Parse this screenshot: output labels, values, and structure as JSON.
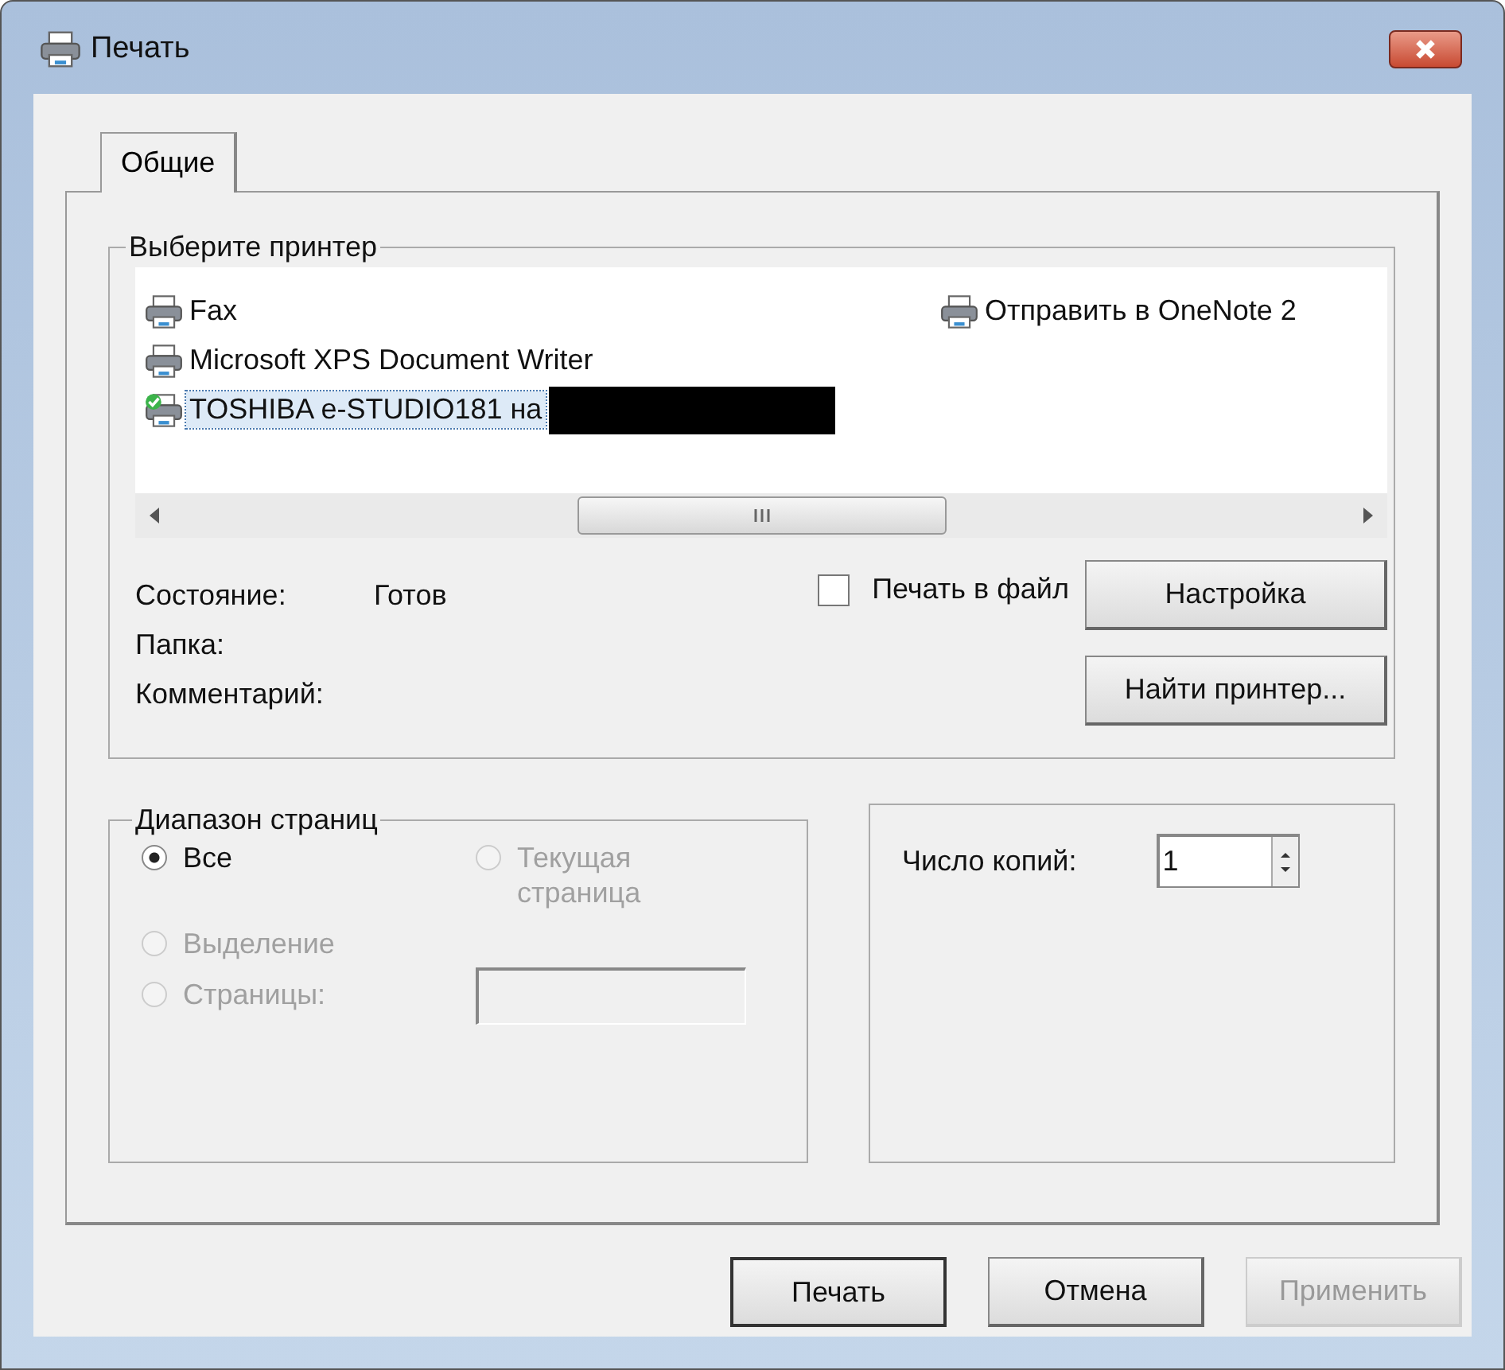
{
  "window": {
    "title": "Печать"
  },
  "tabs": [
    {
      "label": "Общие",
      "selected": true
    }
  ],
  "printer_group": {
    "title": "Выберите принтер",
    "printers": [
      {
        "name": "Fax",
        "selected": false,
        "default": false,
        "redacted": false
      },
      {
        "name": "Microsoft XPS Document Writer",
        "selected": false,
        "default": false,
        "redacted": false
      },
      {
        "name": "TOSHIBA e-STUDIO181 на",
        "selected": true,
        "default": true,
        "redacted": true
      },
      {
        "name": "Отправить в OneNote 2",
        "selected": false,
        "default": false,
        "redacted": false
      }
    ],
    "status": [
      {
        "label": "Состояние:",
        "value": "Готов"
      },
      {
        "label": "Папка:"
      },
      {
        "label": "Комментарий:"
      }
    ],
    "print_to_file": {
      "label": "Печать в файл",
      "checked": false
    },
    "setup_button": "Настройка",
    "find_button": "Найти принтер..."
  },
  "page_range": {
    "title": "Диапазон страниц",
    "options": [
      {
        "label": "Все",
        "selected": true,
        "disabled": false
      },
      {
        "label": "Текущая страница",
        "selected": false,
        "disabled": true
      },
      {
        "label": "Выделение",
        "selected": false,
        "disabled": true
      },
      {
        "label": "Страницы:",
        "selected": false,
        "disabled": true
      }
    ],
    "pages_field": {
      "disabled": true
    }
  },
  "copies": {
    "label": "Число копий:",
    "value": "1"
  },
  "buttons": [
    {
      "label": "Печать",
      "disabled": false,
      "default": true
    },
    {
      "label": "Отмена",
      "disabled": false,
      "default": false
    },
    {
      "label": "Применить",
      "disabled": true,
      "default": false
    }
  ]
}
